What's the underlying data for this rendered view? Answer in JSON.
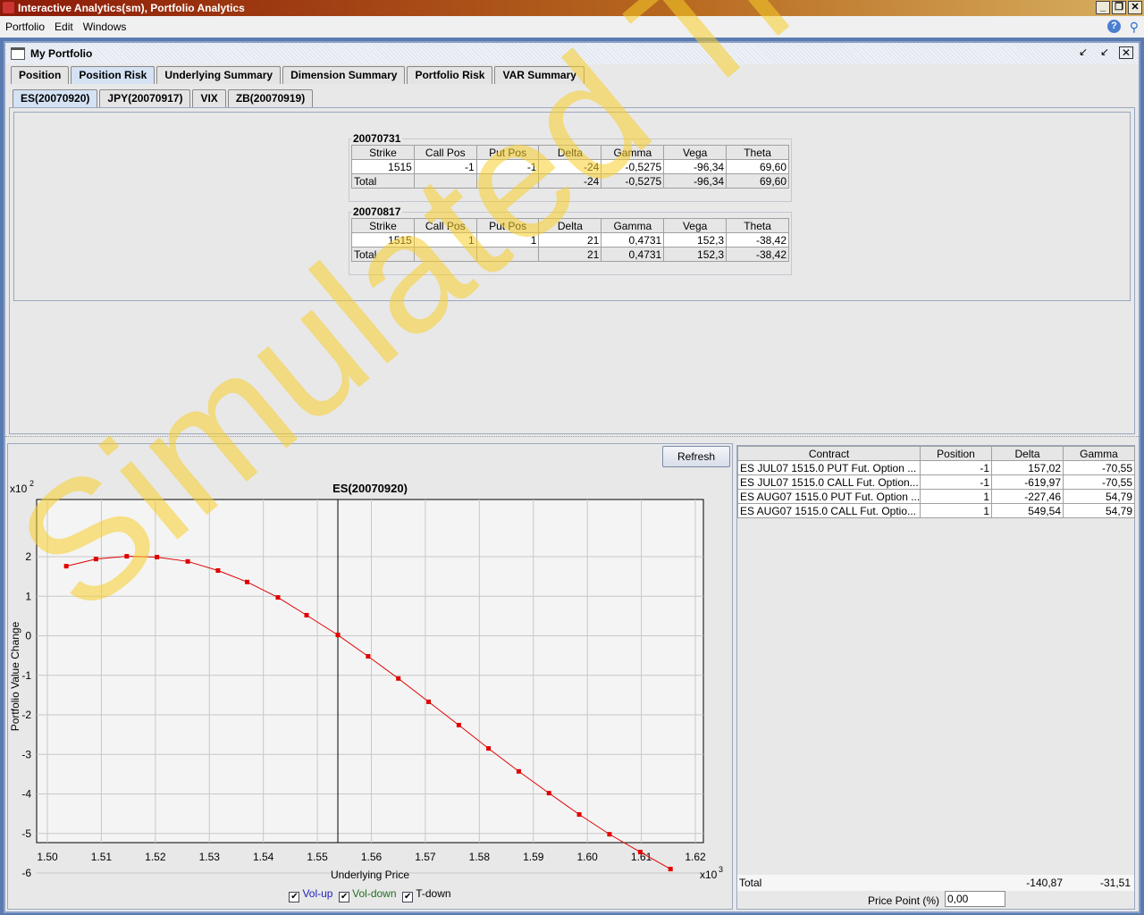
{
  "window": {
    "title": "Interactive Analytics(sm), Portfolio Analytics"
  },
  "menu": [
    "Portfolio",
    "Edit",
    "Windows"
  ],
  "frame": {
    "title": "My Portfolio"
  },
  "tabs": [
    "Position",
    "Position Risk",
    "Underlying Summary",
    "Dimension Summary",
    "Portfolio Risk",
    "VAR Summary"
  ],
  "subtabs": [
    "ES(20070920)",
    "JPY(20070917)",
    "VIX",
    "ZB(20070919)"
  ],
  "risk_columns": [
    "Strike",
    "Call Pos",
    "Put Pos",
    "Delta",
    "Gamma",
    "Vega",
    "Theta"
  ],
  "groups": [
    {
      "expiry": "20070731",
      "row": [
        "1515",
        "-1",
        "-1",
        "-24",
        "-0,5275",
        "-96,34",
        "69,60"
      ],
      "total": [
        "Total",
        "",
        "",
        "-24",
        "-0,5275",
        "-96,34",
        "69,60"
      ]
    },
    {
      "expiry": "20070817",
      "row": [
        "1515",
        "1",
        "1",
        "21",
        "0,4731",
        "152,3",
        "-38,42"
      ],
      "total": [
        "Total",
        "",
        "",
        "21",
        "0,4731",
        "152,3",
        "-38,42"
      ]
    }
  ],
  "refresh_label": "Refresh",
  "contracts": {
    "columns": [
      "Contract",
      "Position",
      "Delta",
      "Gamma"
    ],
    "rows": [
      [
        "ES JUL07 1515.0 PUT Fut. Option ...",
        "-1",
        "157,02",
        "-70,55"
      ],
      [
        "ES JUL07 1515.0 CALL Fut. Option...",
        "-1",
        "-619,97",
        "-70,55"
      ],
      [
        "ES AUG07 1515.0 PUT Fut. Option ...",
        "1",
        "-227,46",
        "54,79"
      ],
      [
        "ES AUG07 1515.0 CALL Fut. Optio...",
        "1",
        "549,54",
        "54,79"
      ]
    ],
    "total_label": "Total",
    "total_delta": "-140,87",
    "total_gamma": "-31,51",
    "price_point_label": "Price Point (%)",
    "price_point_value": "0,00"
  },
  "legend": [
    {
      "label": "Vol-up",
      "color": "#2020c0",
      "checked": true
    },
    {
      "label": "Vol-down",
      "color": "#207020",
      "checked": true
    },
    {
      "label": "T-down",
      "color": "#000000",
      "checked": true
    }
  ],
  "watermark": "Simulated Trading",
  "chart_data": {
    "type": "line",
    "title": "ES(20070920)",
    "xlabel": "Underlying Price",
    "ylabel": "Portfolio Value Change",
    "x_multiplier": "x10",
    "x_exp": "3",
    "y_multiplier": "x10",
    "y_exp": "2",
    "xlim": [
      1.498,
      1.622
    ],
    "ylim": [
      -6.3,
      2.4
    ],
    "xticks": [
      "1.50",
      "1.51",
      "1.52",
      "1.53",
      "1.54",
      "1.55",
      "1.56",
      "1.57",
      "1.58",
      "1.59",
      "1.60",
      "1.61",
      "1.62"
    ],
    "yticks": [
      "2",
      "1",
      "0",
      "-1",
      "-2",
      "-3",
      "-4",
      "-5",
      "-6"
    ],
    "current_price": 1.5538,
    "series": [
      {
        "name": "Portfolio",
        "color": "#e00000",
        "x": [
          1.5035,
          1.509,
          1.5147,
          1.5203,
          1.526,
          1.5316,
          1.537,
          1.5427,
          1.548,
          1.5538,
          1.5594,
          1.565,
          1.5706,
          1.5762,
          1.5817,
          1.5873,
          1.5929,
          1.5985,
          1.6041,
          1.6098,
          1.6154
        ],
        "y": [
          1.76,
          1.94,
          2.01,
          1.99,
          1.88,
          1.65,
          1.36,
          0.97,
          0.52,
          0.02,
          -0.52,
          -1.08,
          -1.67,
          -2.26,
          -2.85,
          -3.43,
          -3.98,
          -4.52,
          -5.02,
          -5.47,
          -5.9
        ]
      }
    ],
    "grid": true
  }
}
